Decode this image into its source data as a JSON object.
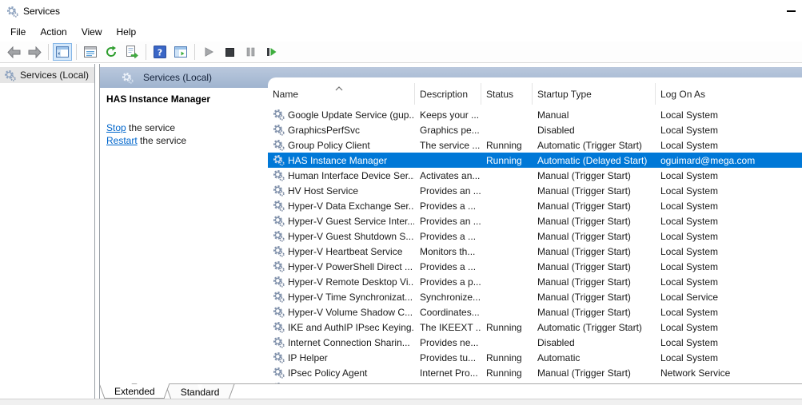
{
  "window": {
    "title": "Services"
  },
  "menu": {
    "items": [
      "File",
      "Action",
      "View",
      "Help"
    ]
  },
  "toolbar": {
    "icons": [
      "back-icon",
      "forward-icon",
      "show-console-tree-icon",
      "properties-icon",
      "refresh-icon",
      "export-list-icon",
      "help-icon",
      "extended-view-icon",
      "start-service-icon",
      "stop-service-icon",
      "pause-service-icon",
      "restart-service-icon"
    ],
    "active_toggle": "show-console-tree-icon"
  },
  "tree": {
    "root_label": "Services (Local)"
  },
  "pane": {
    "header_title": "Services (Local)",
    "selected_service_title": "HAS Instance Manager",
    "stop_link": "Stop",
    "stop_suffix": " the service",
    "restart_link": "Restart",
    "restart_suffix": " the service"
  },
  "table": {
    "columns": [
      "Name",
      "Description",
      "Status",
      "Startup Type",
      "Log On As"
    ],
    "sort_column": "Name",
    "sort_direction": "ascending",
    "rows": [
      {
        "name": "Google Update Service (gup...",
        "description": "Keeps your ...",
        "status": "",
        "startup": "Manual",
        "logon": "Local System",
        "selected": false
      },
      {
        "name": "GraphicsPerfSvc",
        "description": "Graphics pe...",
        "status": "",
        "startup": "Disabled",
        "logon": "Local System",
        "selected": false
      },
      {
        "name": "Group Policy Client",
        "description": "The service ...",
        "status": "Running",
        "startup": "Automatic (Trigger Start)",
        "logon": "Local System",
        "selected": false
      },
      {
        "name": "HAS Instance Manager",
        "description": "",
        "status": "Running",
        "startup": "Automatic (Delayed Start)",
        "logon": "oguimard@mega.com",
        "selected": true
      },
      {
        "name": "Human Interface Device Ser...",
        "description": "Activates an...",
        "status": "",
        "startup": "Manual (Trigger Start)",
        "logon": "Local System",
        "selected": false
      },
      {
        "name": "HV Host Service",
        "description": "Provides an ...",
        "status": "",
        "startup": "Manual (Trigger Start)",
        "logon": "Local System",
        "selected": false
      },
      {
        "name": "Hyper-V Data Exchange Ser...",
        "description": "Provides a ...",
        "status": "",
        "startup": "Manual (Trigger Start)",
        "logon": "Local System",
        "selected": false
      },
      {
        "name": "Hyper-V Guest Service Inter...",
        "description": "Provides an ...",
        "status": "",
        "startup": "Manual (Trigger Start)",
        "logon": "Local System",
        "selected": false
      },
      {
        "name": "Hyper-V Guest Shutdown S...",
        "description": "Provides a ...",
        "status": "",
        "startup": "Manual (Trigger Start)",
        "logon": "Local System",
        "selected": false
      },
      {
        "name": "Hyper-V Heartbeat Service",
        "description": "Monitors th...",
        "status": "",
        "startup": "Manual (Trigger Start)",
        "logon": "Local System",
        "selected": false
      },
      {
        "name": "Hyper-V PowerShell Direct ...",
        "description": "Provides a ...",
        "status": "",
        "startup": "Manual (Trigger Start)",
        "logon": "Local System",
        "selected": false
      },
      {
        "name": "Hyper-V Remote Desktop Vi...",
        "description": "Provides a p...",
        "status": "",
        "startup": "Manual (Trigger Start)",
        "logon": "Local System",
        "selected": false
      },
      {
        "name": "Hyper-V Time Synchronizat...",
        "description": "Synchronize...",
        "status": "",
        "startup": "Manual (Trigger Start)",
        "logon": "Local Service",
        "selected": false
      },
      {
        "name": "Hyper-V Volume Shadow C...",
        "description": "Coordinates...",
        "status": "",
        "startup": "Manual (Trigger Start)",
        "logon": "Local System",
        "selected": false
      },
      {
        "name": "IKE and AuthIP IPsec Keying...",
        "description": "The IKEEXT ...",
        "status": "Running",
        "startup": "Automatic (Trigger Start)",
        "logon": "Local System",
        "selected": false
      },
      {
        "name": "Internet Connection Sharin...",
        "description": "Provides ne...",
        "status": "",
        "startup": "Disabled",
        "logon": "Local System",
        "selected": false
      },
      {
        "name": "IP Helper",
        "description": "Provides tu...",
        "status": "Running",
        "startup": "Automatic",
        "logon": "Local System",
        "selected": false
      },
      {
        "name": "IPsec Policy Agent",
        "description": "Internet Pro...",
        "status": "Running",
        "startup": "Manual (Trigger Start)",
        "logon": "Network Service",
        "selected": false
      }
    ],
    "partial_row_visible": true
  },
  "tabs": [
    {
      "label": "Extended",
      "active": true
    },
    {
      "label": "Standard",
      "active": false
    }
  ],
  "colors": {
    "selection": "#0078d7",
    "band_top": "#bac8dd",
    "band_bottom": "#a0b4cf",
    "link": "#0066cc",
    "tree_selected_bg": "#e5e5e5"
  }
}
